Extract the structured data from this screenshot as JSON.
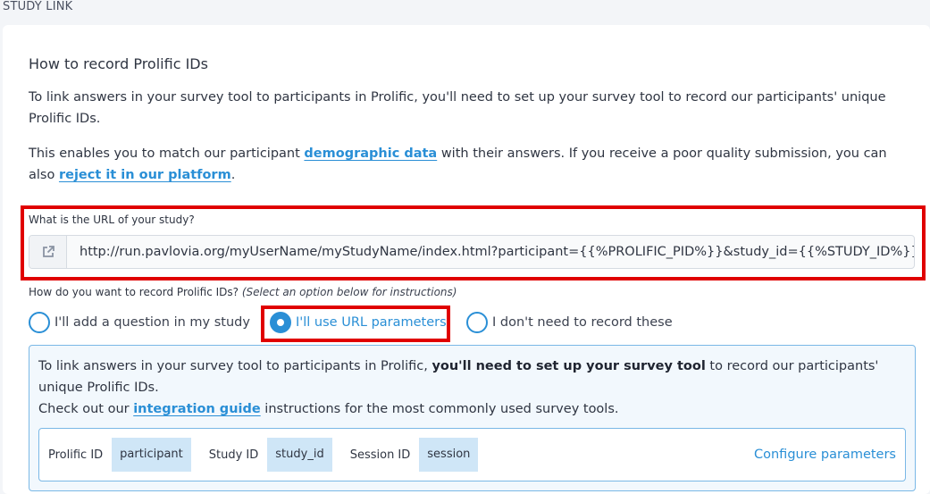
{
  "section": {
    "label": "STUDY LINK"
  },
  "heading": "How to record Prolific IDs",
  "para1": "To link answers in your survey tool to participants in Prolific, you'll need to set up your survey tool to record our participants' unique Prolific IDs.",
  "para2": {
    "before": "This enables you to match our participant ",
    "link1": "demographic data",
    "middle": " with their answers. If you receive a poor quality submission, you can also ",
    "link2": "reject it in our platform",
    "after": "."
  },
  "url": {
    "label": "What is the URL of your study?",
    "value": "http://run.pavlovia.org/myUserName/myStudyName/index.html?participant={{%PROLIFIC_PID%}}&study_id={{%STUDY_ID%}}&session={{%SESSION_ID%}}",
    "icon": "external-link-icon"
  },
  "record": {
    "question": "How do you want to record Prolific IDs?",
    "hint": "(Select an option below for instructions)",
    "options": [
      {
        "label": "I'll add a question in my study",
        "selected": false
      },
      {
        "label": "I'll use URL parameters",
        "selected": true
      },
      {
        "label": "I don't need to record these",
        "selected": false
      }
    ]
  },
  "info": {
    "line1_before": "To link answers in your survey tool to participants in Prolific, ",
    "line1_bold": "you'll need to set up your survey tool",
    "line1_after": " to record our participants' unique Prolific IDs.",
    "line2_before": "Check out our ",
    "line2_link": "integration guide",
    "line2_after": " instructions for the most commonly used survey tools."
  },
  "params": {
    "prolific_label": "Prolific ID",
    "prolific_value": "participant",
    "study_label": "Study ID",
    "study_value": "study_id",
    "session_label": "Session ID",
    "session_value": "session",
    "configure": "Configure parameters"
  },
  "colors": {
    "accent": "#2a8fd6",
    "highlight": "#e00000",
    "param_bg": "#cfe6f7"
  }
}
